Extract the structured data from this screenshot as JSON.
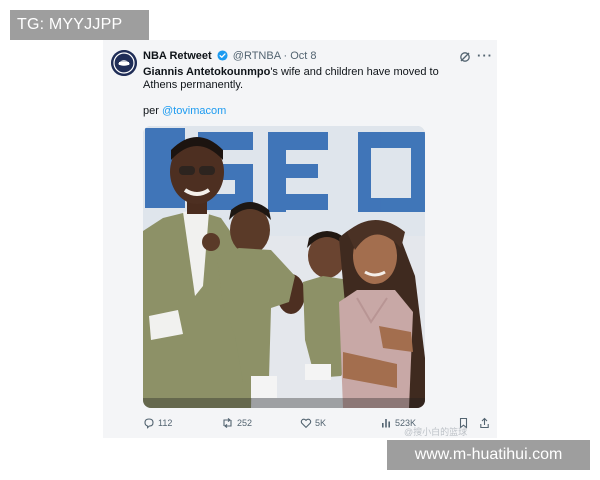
{
  "watermarks": {
    "top": "TG: MYYJJPP",
    "bottom": "www.m-huatihui.com"
  },
  "tweet": {
    "author_name": "NBA Retweet",
    "handle": "@RTNBA",
    "separator": "·",
    "date": "Oct 8",
    "text_bold": "Giannis Antetokounmpo",
    "text_rest": "'s wife and children have moved to Athens permanently.",
    "credit_prefix": "per",
    "credit_link": "@tovimacom",
    "more_label": "···",
    "icons": [
      "verified-badge",
      "grok-icon",
      "more-icon"
    ]
  },
  "actions": {
    "reply_count": "112",
    "repost_count": "252",
    "like_count": "5K",
    "views_count": "523K",
    "icons": [
      "reply-icon",
      "repost-icon",
      "like-icon",
      "views-icon",
      "bookmark-icon",
      "share-icon"
    ]
  },
  "overlay_watermark": "@搜小白的篮球"
}
